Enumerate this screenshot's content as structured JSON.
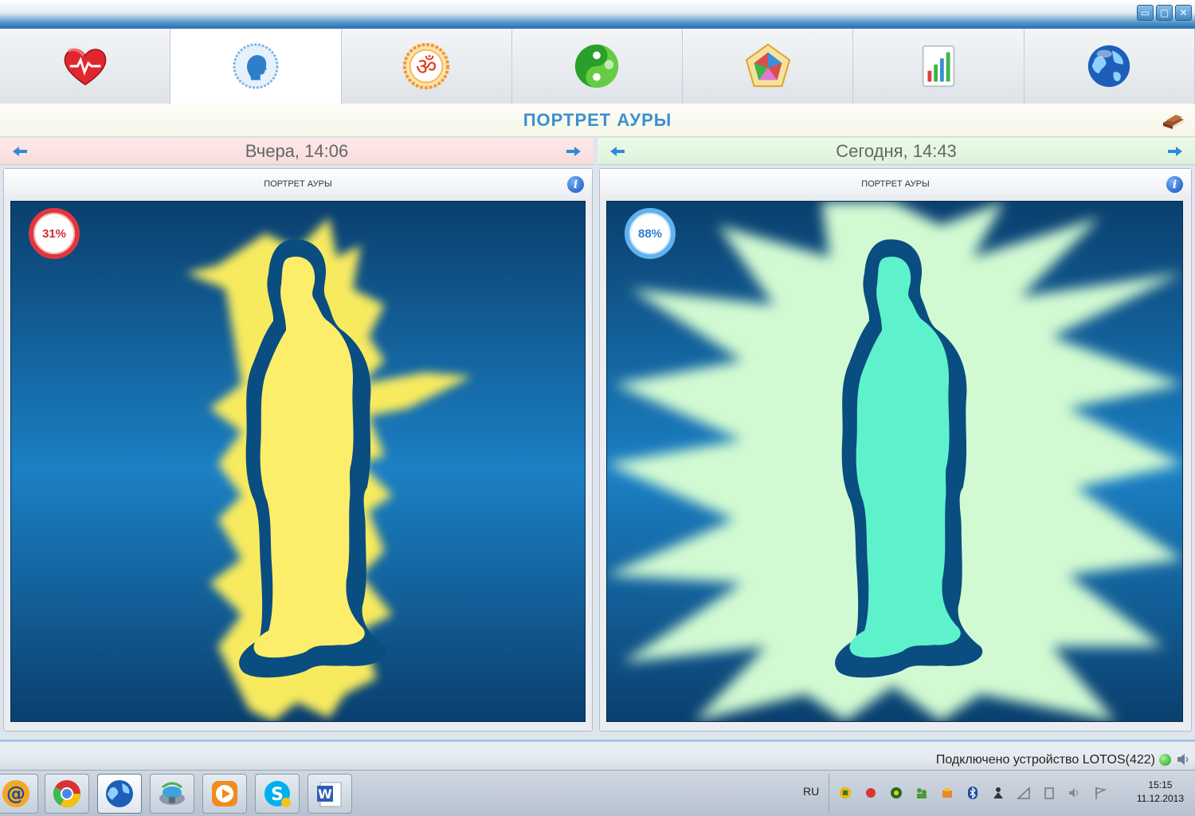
{
  "window": {
    "buttons": {
      "minimize": "▭",
      "maximize": "▢",
      "close": "✕"
    }
  },
  "toolbar": {
    "tabs": [
      {
        "icon": "heart-pulse-icon",
        "active": false
      },
      {
        "icon": "head-profile-icon",
        "active": true
      },
      {
        "icon": "om-symbol-icon",
        "active": false
      },
      {
        "icon": "yin-yang-icon",
        "active": false
      },
      {
        "icon": "pentagon-chart-icon",
        "active": false
      },
      {
        "icon": "bar-chart-icon",
        "active": false
      },
      {
        "icon": "globe-icon",
        "active": false
      }
    ]
  },
  "header": {
    "title": "ПОРТРЕТ АУРЫ",
    "icon": "book-icon"
  },
  "left_panel": {
    "date": "Вчера, 14:06",
    "title": "ПОРТРЕТ АУРЫ",
    "percent": "31%",
    "percent_value": 31,
    "aura_color": "#f7ea5e",
    "body_color": "#fcee6a",
    "nav_background": "#fbe3e3"
  },
  "right_panel": {
    "date": "Сегодня, 14:43",
    "title": "ПОРТРЕТ АУРЫ",
    "percent": "88%",
    "percent_value": 88,
    "aura_color": "#d2fad2",
    "body_color": "#5ef2cc",
    "nav_background": "#e4f8e2"
  },
  "status": {
    "text": "Подключено устройство LOTOS(422)",
    "indicator_color": "#2ea82a"
  },
  "taskbar": {
    "apps": [
      {
        "icon": "mail-at-icon",
        "active": false
      },
      {
        "icon": "chrome-icon",
        "active": false
      },
      {
        "icon": "globe-app-icon",
        "active": true
      },
      {
        "icon": "network-device-icon",
        "active": false
      },
      {
        "icon": "media-player-icon",
        "active": false
      },
      {
        "icon": "skype-icon",
        "active": false
      },
      {
        "icon": "word-icon",
        "active": false
      }
    ],
    "language": "RU",
    "time": "15:15",
    "date": "11.12.2013"
  }
}
